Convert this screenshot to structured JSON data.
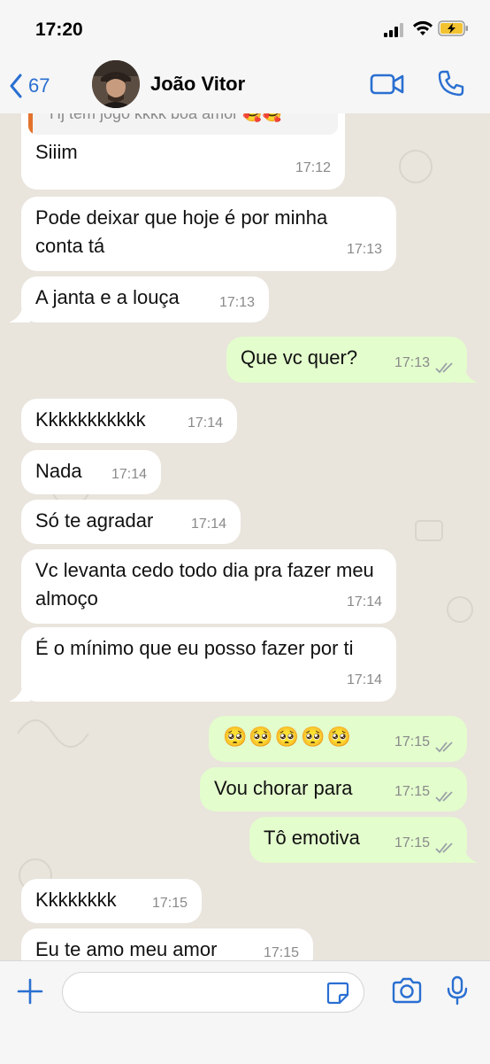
{
  "status_bar": {
    "time": "17:20"
  },
  "header": {
    "back_count": "67",
    "contact_name": "João Vitor"
  },
  "reply_preview": {
    "text": "Hj tem jogo kkkk boa amor 🥰🥰"
  },
  "messages": [
    {
      "text": "Siiim",
      "time": "17:12",
      "direction": "in"
    },
    {
      "text": "Pode deixar que hoje é por minha conta tá",
      "time": "17:13",
      "direction": "in"
    },
    {
      "text": "A janta e a louça",
      "time": "17:13",
      "direction": "in"
    },
    {
      "text": "Que vc quer?",
      "time": "17:13",
      "direction": "out"
    },
    {
      "text": "Kkkkkkkkkkk",
      "time": "17:14",
      "direction": "in"
    },
    {
      "text": "Nada",
      "time": "17:14",
      "direction": "in"
    },
    {
      "text": "Só te agradar",
      "time": "17:14",
      "direction": "in"
    },
    {
      "text": "Vc levanta cedo todo dia pra fazer meu almoço",
      "time": "17:14",
      "direction": "in"
    },
    {
      "text": "É o mínimo que eu posso fazer por ti",
      "time": "17:14",
      "direction": "in"
    },
    {
      "text": "🥺🥺🥺🥺🥺",
      "time": "17:15",
      "direction": "out"
    },
    {
      "text": "Vou chorar para",
      "time": "17:15",
      "direction": "out"
    },
    {
      "text": "Tô emotiva",
      "time": "17:15",
      "direction": "out"
    },
    {
      "text": "Kkkkkkkk",
      "time": "17:15",
      "direction": "in"
    },
    {
      "text": "Eu te amo meu amor",
      "time": "17:15",
      "direction": "in"
    }
  ],
  "icons": {
    "back": "chevron-left-icon",
    "video": "video-camera-icon",
    "phone": "phone-icon",
    "plus": "plus-icon",
    "sticker": "sticker-icon",
    "camera": "camera-icon",
    "mic": "microphone-icon"
  },
  "colors": {
    "accent": "#2a6fd1",
    "incoming_bubble": "#ffffff",
    "outgoing_bubble": "#e3fdcd",
    "read_ticks": "#9aa0a6",
    "reply_bar": "#e3732d"
  }
}
